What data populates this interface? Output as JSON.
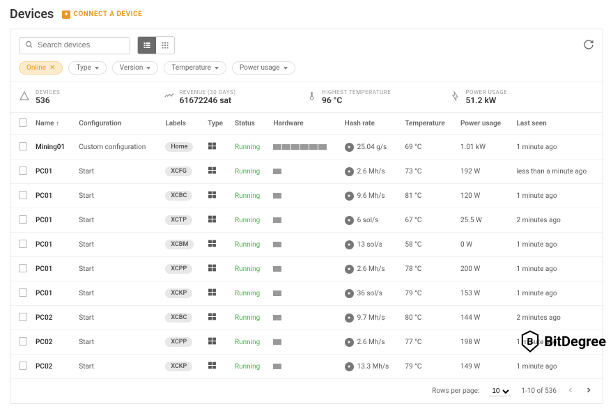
{
  "header": {
    "title": "Devices",
    "connect_label": "CONNECT A DEVICE"
  },
  "search": {
    "placeholder": "Search devices"
  },
  "filters": {
    "active": {
      "label": "Online"
    },
    "items": [
      {
        "label": "Type"
      },
      {
        "label": "Version"
      },
      {
        "label": "Temperature"
      },
      {
        "label": "Power usage"
      }
    ]
  },
  "stats": {
    "devices": {
      "label": "DEVICES",
      "value": "536"
    },
    "revenue": {
      "label": "REVENUE (30 DAYS)",
      "value": "61672246 sat"
    },
    "temp": {
      "label": "HIGHEST TEMPERATURE",
      "value": "96 °C"
    },
    "power": {
      "label": "POWER USAGE",
      "value": "51.2 kW"
    }
  },
  "columns": {
    "name": "Name",
    "config": "Configuration",
    "labels": "Labels",
    "type": "Type",
    "status": "Status",
    "hardware": "Hardware",
    "hash": "Hash rate",
    "temp": "Temperature",
    "power": "Power usage",
    "last": "Last seen"
  },
  "rows": [
    {
      "name": "Mining01",
      "config": "Custom configuration",
      "label": "Home",
      "status": "Running",
      "bars": 6,
      "hash": "25.04 g/s",
      "temp": "69 °C",
      "power": "1.01 kW",
      "last": "1 minute ago"
    },
    {
      "name": "PC01",
      "config": "Start",
      "label": "XCFG",
      "status": "Running",
      "bars": 1,
      "hash": "2.6 Mh/s",
      "temp": "73 °C",
      "power": "192 W",
      "last": "less than a minute ago"
    },
    {
      "name": "PC01",
      "config": "Start",
      "label": "XCBC",
      "status": "Running",
      "bars": 1,
      "hash": "9.6 Mh/s",
      "temp": "81 °C",
      "power": "120 W",
      "last": "1 minute ago"
    },
    {
      "name": "PC01",
      "config": "Start",
      "label": "XCTP",
      "status": "Running",
      "bars": 1,
      "hash": "6 sol/s",
      "temp": "67 °C",
      "power": "25.5 W",
      "last": "2 minutes ago"
    },
    {
      "name": "PC01",
      "config": "Start",
      "label": "XCBM",
      "status": "Running",
      "bars": 1,
      "hash": "13 sol/s",
      "temp": "58 °C",
      "power": "0 W",
      "last": "1 minute ago"
    },
    {
      "name": "PC01",
      "config": "Start",
      "label": "XCPP",
      "status": "Running",
      "bars": 1,
      "hash": "2.6 Mh/s",
      "temp": "78 °C",
      "power": "200 W",
      "last": "1 minute ago"
    },
    {
      "name": "PC01",
      "config": "Start",
      "label": "XCKP",
      "status": "Running",
      "bars": 1,
      "hash": "36 sol/s",
      "temp": "79 °C",
      "power": "153 W",
      "last": "1 minute ago"
    },
    {
      "name": "PC02",
      "config": "Start",
      "label": "XCBC",
      "status": "Running",
      "bars": 1,
      "hash": "9.7 Mh/s",
      "temp": "80 °C",
      "power": "144 W",
      "last": "2 minutes ago"
    },
    {
      "name": "PC02",
      "config": "Start",
      "label": "XCPP",
      "status": "Running",
      "bars": 1,
      "hash": "2.6 Mh/s",
      "temp": "77 °C",
      "power": "198 W",
      "last": "1 minute ago"
    },
    {
      "name": "PC02",
      "config": "Start",
      "label": "XCKP",
      "status": "Running",
      "bars": 1,
      "hash": "13.3 Mh/s",
      "temp": "79 °C",
      "power": "149 W",
      "last": "1 minute ago"
    }
  ],
  "pager": {
    "rows_label": "Rows per page:",
    "rows_value": "10",
    "range": "1-10 of 536"
  },
  "watermark": "BitDegree"
}
